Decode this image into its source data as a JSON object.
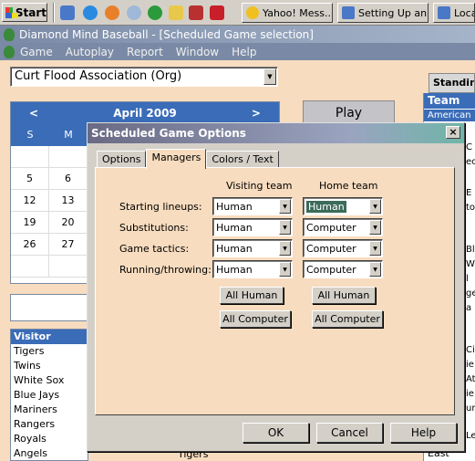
{
  "taskbar": {
    "start_label": "Start",
    "tasks": [
      "Yahoo! Mess...",
      "Setting Up an...",
      "Loca"
    ]
  },
  "app": {
    "title": "Diamond Mind Baseball - [Scheduled Game selection]",
    "menu": [
      "Game",
      "Autoplay",
      "Report",
      "Window",
      "Help"
    ]
  },
  "org_select": {
    "value": "Curt Flood Association (Org)"
  },
  "calendar": {
    "prev": "<",
    "next": ">",
    "month": "April 2009",
    "dow": [
      "S",
      "M"
    ],
    "rows": [
      [
        "",
        ""
      ],
      [
        "5",
        "6"
      ],
      [
        "12",
        "13"
      ],
      [
        "19",
        "20"
      ],
      [
        "26",
        "27"
      ],
      [
        "",
        ""
      ]
    ]
  },
  "play_button": "Play",
  "visitors": {
    "header": "Visitor",
    "teams": [
      "Tigers",
      "Twins",
      "White Sox",
      "Blue Jays",
      "Mariners",
      "Rangers",
      "Royals",
      "Angels"
    ]
  },
  "bottom_team": "Tigers",
  "standings": {
    "tab": "Standings",
    "team_header": "Team",
    "league": "American L",
    "fragments": [
      "C",
      "ec",
      "E",
      "E",
      "tor",
      "Blu",
      "W",
      "l",
      "ge",
      "a",
      "Cit",
      "ie",
      "At",
      "ie",
      "ur",
      "Le"
    ],
    "east": "East"
  },
  "dialog": {
    "title": "Scheduled Game Options",
    "close": "×",
    "tabs": [
      "Options",
      "Managers",
      "Colors / Text"
    ],
    "active_tab": "Managers",
    "col_visiting": "Visiting team",
    "col_home": "Home team",
    "rows": [
      {
        "label": "Starting lineups:",
        "visiting": "Human",
        "home": "Human"
      },
      {
        "label": "Substitutions:",
        "visiting": "Human",
        "home": "Computer"
      },
      {
        "label": "Game tactics:",
        "visiting": "Human",
        "home": "Computer"
      },
      {
        "label": "Running/throwing:",
        "visiting": "Human",
        "home": "Computer"
      }
    ],
    "all_human": "All Human",
    "all_computer": "All Computer",
    "ok": "OK",
    "cancel": "Cancel",
    "help": "Help"
  }
}
